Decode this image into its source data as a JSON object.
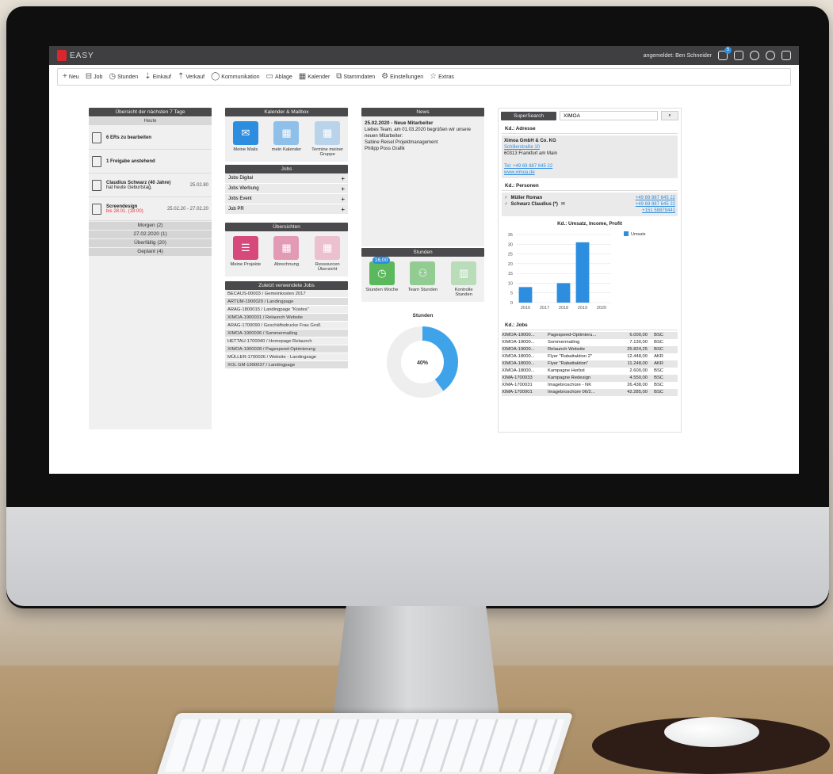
{
  "app": {
    "logo_text": "EASY",
    "user_label": "angemeldet: Ben Schneider",
    "mail_badge": "5"
  },
  "toolbar": {
    "items": [
      {
        "icon": "plus-icon",
        "label": "Neu"
      },
      {
        "icon": "job-icon",
        "label": "Job"
      },
      {
        "icon": "clock-icon",
        "label": "Stunden"
      },
      {
        "icon": "purchase-icon",
        "label": "Einkauf"
      },
      {
        "icon": "sale-icon",
        "label": "Verkauf"
      },
      {
        "icon": "chat-icon",
        "label": "Kommunikation"
      },
      {
        "icon": "folder-icon",
        "label": "Ablage"
      },
      {
        "icon": "calendar-icon",
        "label": "Kalender"
      },
      {
        "icon": "master-data-icon",
        "label": "Stammdaten"
      },
      {
        "icon": "gear-icon",
        "label": "Einstellungen"
      },
      {
        "icon": "star-icon",
        "label": "Extras"
      }
    ]
  },
  "overview": {
    "title": "Übersicht der nächsten 7 Tage",
    "today_label": "Heute",
    "tasks": [
      {
        "title": "6 ERs zu bearbeiten",
        "sub": "",
        "date": ""
      },
      {
        "title": "1 Freigabe anstehend",
        "sub": "",
        "date": ""
      },
      {
        "title": "Claudius Schwarz (40 Jahre)",
        "sub": "hat heute Geburtstag.",
        "date": "25.02.80"
      },
      {
        "title": "Screendesign",
        "sub": "bis 28.01. (18:00)",
        "date": "25.02.20 - 27.02.20"
      }
    ],
    "summary": [
      "Morgen (2)",
      "27.02.2020 (1)",
      "Überfällig (20)",
      "Geplant (4)"
    ]
  },
  "calendar_mail": {
    "title": "Kalender & Mailbox",
    "tiles": [
      {
        "icon": "mail-icon",
        "label": "Meine Mails"
      },
      {
        "icon": "calendar-icon",
        "label": "mein Kalender"
      },
      {
        "icon": "group-calendar-icon",
        "label": "Termine meiner Gruppe"
      }
    ]
  },
  "jobs": {
    "title": "Jobs",
    "items": [
      "Jobs Digital",
      "Jobs Werbung",
      "Jobs Event",
      "Job PR"
    ]
  },
  "overviews": {
    "title": "Übersichten",
    "tiles": [
      {
        "icon": "list-icon",
        "label": "Meine Projekte"
      },
      {
        "icon": "calculator-icon",
        "label": "Abrechnung"
      },
      {
        "icon": "grid-icon",
        "label": "Ressourcen Übersicht"
      }
    ]
  },
  "recent_jobs": {
    "title": "Zuletzt verwendete Jobs",
    "items": [
      "BECAUS-00003 / Gemeinkosten 2017",
      "ARTUM-1900029 / Landingpage",
      "ARAG-1800015 / Landingpage \"Kostes\"",
      "XIMOA-1900031 / Relaunch Website",
      "ARAG-1700090 / Geschäftsdrucke Frau Groß",
      "XIMOA-1900036 / Sommermailing",
      "HETTAU-1700040 / Homepage Relaunch",
      "XIMOA-1900028 / Pagespeed-Optimierung",
      "MÜLLER-1700026 / Website - Landingsage",
      "XOL GM-1990037 / Landingpage"
    ]
  },
  "news": {
    "title": "News",
    "headline": "25.02.2020 - Neue Mitarbeiter",
    "body": "Liebes Team, am 01.03.2020 begrüßen wir unsere neuen Mitarbeiter:",
    "names": [
      "Sabine Reisel Projektmanagement",
      "Philipp Poss Grafik"
    ]
  },
  "hours": {
    "title": "Stunden",
    "badge": "16,00",
    "tiles": [
      {
        "icon": "clock-icon",
        "label": "Stunden Woche"
      },
      {
        "icon": "team-icon",
        "label": "Team Stunden"
      },
      {
        "icon": "bar-chart-icon",
        "label": "Kontrolle Stunden"
      }
    ],
    "donut_title": "Stunden",
    "donut_label": "40%",
    "donut_value": 0.4
  },
  "supersearch": {
    "title": "SuperSearch",
    "query": "XIMOA",
    "address_title": "Kd.: Adresse",
    "company": "Ximoa GmbH & Co. KG",
    "street": "Schillerstraße 10",
    "city": "60313 Frankfurt am Main",
    "tel": "Tel: +49 69 887 645 22",
    "www": "www.ximoa.de",
    "persons_title": "Kd.: Personen",
    "persons": [
      {
        "name": "Müller Roman",
        "phone": "+49 69 887 645 22"
      },
      {
        "name": "Schwarz Claudius (*)",
        "phone": "+49 69 887 645 22",
        "phone2": "+151 58879441"
      }
    ],
    "chart_title": "Kd.: Umsatz, Income, Profit",
    "jobs_title": "Kd.: Jobs",
    "jobs": [
      {
        "id": "XIMOA-19000...",
        "name": "Pagespeed-Optimieru...",
        "amount": "6.000,00",
        "cur": "BSC"
      },
      {
        "id": "XIMOA-19000...",
        "name": "Sommermailing",
        "amount": "7.130,00",
        "cur": "BSC"
      },
      {
        "id": "XIMOA-19000...",
        "name": "Relaunch Website",
        "amount": "25.824,25",
        "cur": "BSC"
      },
      {
        "id": "XIMOA-18000...",
        "name": "Flyer \"Rabattaktion 2\"",
        "amount": "12.448,00",
        "cur": "AKR"
      },
      {
        "id": "XIMOA-18000...",
        "name": "Flyer \"Rabattaktion\"",
        "amount": "11.248,00",
        "cur": "AKR"
      },
      {
        "id": "XIMOA-18000...",
        "name": "Kampagne Herbst",
        "amount": "2.600,00",
        "cur": "BSC"
      },
      {
        "id": "XIMA-1700033",
        "name": "Kampagne Redesign",
        "amount": "4.550,00",
        "cur": "BSC"
      },
      {
        "id": "XIMA-1700031",
        "name": "Imagebroschüre - NK",
        "amount": "26.438,00",
        "cur": "BSC"
      },
      {
        "id": "XIMA-1700001",
        "name": "Imagebroschüre 06/2...",
        "amount": "42.285,00",
        "cur": "BSC"
      }
    ]
  },
  "chart_data": {
    "type": "bar",
    "title": "Kd.: Umsatz, Income, Profit",
    "categories": [
      "2016",
      "2017",
      "2018",
      "2019",
      "2020"
    ],
    "series": [
      {
        "name": "Umsatz",
        "values": [
          8,
          0,
          10,
          31,
          0
        ]
      }
    ],
    "ylim": [
      0,
      35
    ],
    "yticks": [
      0,
      5,
      10,
      15,
      20,
      25,
      30,
      35
    ],
    "color": "#2d8ee0",
    "legend": "top-right"
  }
}
